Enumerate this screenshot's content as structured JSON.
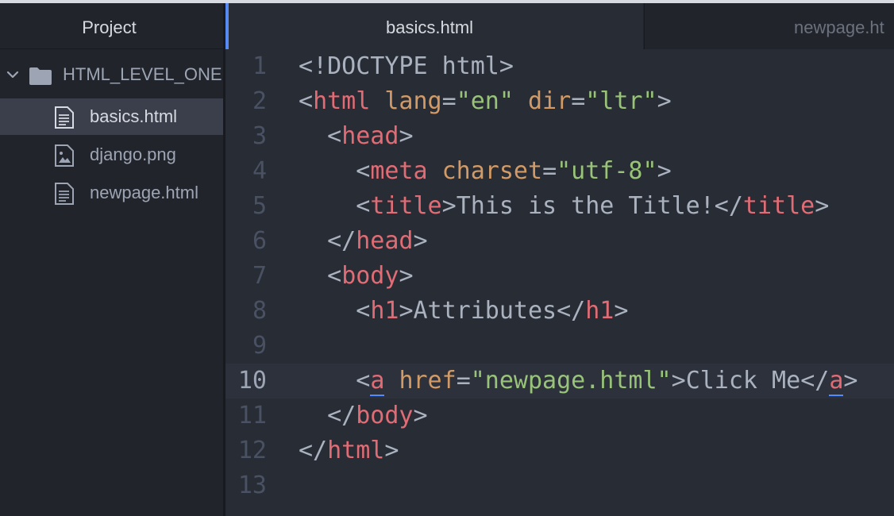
{
  "sidebar": {
    "title": "Project",
    "root_folder": "HTML_LEVEL_ONE",
    "files": [
      {
        "name": "basics.html",
        "icon": "file-text-icon",
        "selected": true
      },
      {
        "name": "django.png",
        "icon": "image-file-icon",
        "selected": false
      },
      {
        "name": "newpage.html",
        "icon": "file-text-icon",
        "selected": false
      }
    ]
  },
  "tabs": [
    {
      "label": "basics.html",
      "active": true
    },
    {
      "label": "newpage.ht",
      "active": false
    }
  ],
  "editor": {
    "cursor_line": 10,
    "lines": [
      {
        "n": "1",
        "tokens": [
          [
            "pun",
            "<"
          ],
          [
            "doc",
            "!DOCTYPE html"
          ],
          [
            "pun",
            ">"
          ]
        ]
      },
      {
        "n": "2",
        "tokens": [
          [
            "pun",
            "<"
          ],
          [
            "tag",
            "html"
          ],
          [
            "pun",
            " "
          ],
          [
            "attr",
            "lang"
          ],
          [
            "pun",
            "="
          ],
          [
            "str",
            "\"en\""
          ],
          [
            "pun",
            " "
          ],
          [
            "attr",
            "dir"
          ],
          [
            "pun",
            "="
          ],
          [
            "str",
            "\"ltr\""
          ],
          [
            "pun",
            ">"
          ]
        ]
      },
      {
        "n": "3",
        "tokens": [
          [
            "pun",
            "  <"
          ],
          [
            "tag",
            "head"
          ],
          [
            "pun",
            ">"
          ]
        ]
      },
      {
        "n": "4",
        "tokens": [
          [
            "pun",
            "    <"
          ],
          [
            "tag",
            "meta"
          ],
          [
            "pun",
            " "
          ],
          [
            "attr",
            "charset"
          ],
          [
            "pun",
            "="
          ],
          [
            "str",
            "\"utf-8\""
          ],
          [
            "pun",
            ">"
          ]
        ]
      },
      {
        "n": "5",
        "tokens": [
          [
            "pun",
            "    <"
          ],
          [
            "tag",
            "title"
          ],
          [
            "pun",
            ">"
          ],
          [
            "txt",
            "This is the Title!"
          ],
          [
            "pun",
            "</"
          ],
          [
            "tag",
            "title"
          ],
          [
            "pun",
            ">"
          ]
        ]
      },
      {
        "n": "6",
        "tokens": [
          [
            "pun",
            "  </"
          ],
          [
            "tag",
            "head"
          ],
          [
            "pun",
            ">"
          ]
        ]
      },
      {
        "n": "7",
        "tokens": [
          [
            "pun",
            "  <"
          ],
          [
            "tag",
            "body"
          ],
          [
            "pun",
            ">"
          ]
        ]
      },
      {
        "n": "8",
        "tokens": [
          [
            "pun",
            "    <"
          ],
          [
            "tag",
            "h1"
          ],
          [
            "pun",
            ">"
          ],
          [
            "txt",
            "Attributes"
          ],
          [
            "pun",
            "</"
          ],
          [
            "tag",
            "h1"
          ],
          [
            "pun",
            ">"
          ]
        ]
      },
      {
        "n": "9",
        "tokens": []
      },
      {
        "n": "10",
        "tokens": [
          [
            "pun",
            "    <"
          ],
          [
            "tagm",
            "a"
          ],
          [
            "pun",
            " "
          ],
          [
            "attr",
            "href"
          ],
          [
            "pun",
            "="
          ],
          [
            "str",
            "\"newpage.html\""
          ],
          [
            "pun",
            ">"
          ],
          [
            "txt",
            "Click Me"
          ],
          [
            "pun",
            "</"
          ],
          [
            "tagm",
            "a"
          ],
          [
            "pun",
            ">"
          ]
        ]
      },
      {
        "n": "11",
        "tokens": [
          [
            "pun",
            "  </"
          ],
          [
            "tag",
            "body"
          ],
          [
            "pun",
            ">"
          ]
        ]
      },
      {
        "n": "12",
        "tokens": [
          [
            "pun",
            "</"
          ],
          [
            "tag",
            "html"
          ],
          [
            "pun",
            ">"
          ]
        ]
      },
      {
        "n": "13",
        "tokens": []
      }
    ]
  },
  "colors": {
    "background": "#282c34",
    "sidebar": "#21252b",
    "tag": "#e06c75",
    "attribute": "#d19a66",
    "string": "#98c379",
    "accent": "#568af2"
  }
}
